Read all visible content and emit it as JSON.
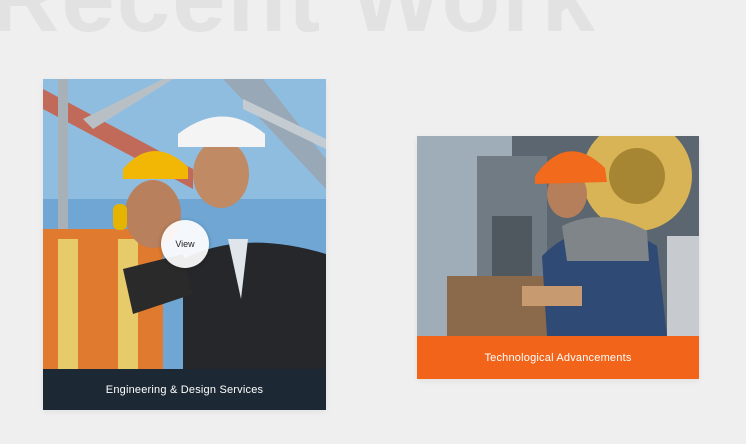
{
  "section": {
    "heading": "Recent Work"
  },
  "projects": [
    {
      "title": "Engineering & Design Services",
      "hover_label": "View",
      "image": "engineers-with-hardhats-photo"
    },
    {
      "title": "Technological Advancements",
      "image": "worker-operating-machine-photo"
    }
  ],
  "colors": {
    "background": "#efefef",
    "caption_dark": "#1c2833",
    "caption_accent": "#f26419"
  }
}
